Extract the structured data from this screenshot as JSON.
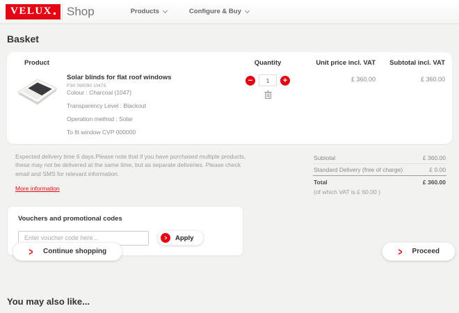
{
  "header": {
    "logo_text": "VELUX",
    "shop_label": "Shop",
    "nav": [
      {
        "label": "Products"
      },
      {
        "label": "Configure & Buy"
      }
    ]
  },
  "basket": {
    "title": "Basket"
  },
  "table": {
    "headers": {
      "product": "Product",
      "quantity": "Quantity",
      "unit_price": "Unit price incl. VAT",
      "subtotal": "Subtotal incl. VAT"
    }
  },
  "product": {
    "name": "Solar blinds for flat roof windows",
    "sku": "FSK 090090 1047S",
    "colour": "Colour : Charcoal (1047)",
    "transparency": "Transparency Level : Blackout",
    "operation": "Operation method : Solar",
    "fit": "To fit window CVP 000000",
    "quantity": "1",
    "unit_price": "£ 360.00",
    "subtotal": "£ 360.00"
  },
  "icons": {
    "minus": "−",
    "plus": "+",
    "arrow_right": ">"
  },
  "delivery": {
    "text": "Expected delivery time 6 days.Please note that if you have purchased multiple products, these may not be delivered at the same time, but as separate deliveries.  Please check email and SMS for relevant information.",
    "more_info_label": "More information"
  },
  "totals": {
    "subtotal_label": "Subtotal",
    "subtotal_value": "£ 360.00",
    "delivery_label": "Standard Delivery (free of charge)",
    "delivery_value": "£ 0.00",
    "total_label": "Total",
    "total_value": "£ 360.00",
    "vat_note": "(of which VAT is £ 60.00 )"
  },
  "voucher": {
    "title": "Vouchers and promotional codes",
    "placeholder": "Enter voucher code here...",
    "apply_label": "Apply"
  },
  "actions": {
    "continue_label": "Continue shopping",
    "proceed_label": "Proceed"
  },
  "recommendations": {
    "title": "You may also like..."
  },
  "colors": {
    "brand_red": "#e30613",
    "page_background": "#f2f2f1"
  }
}
